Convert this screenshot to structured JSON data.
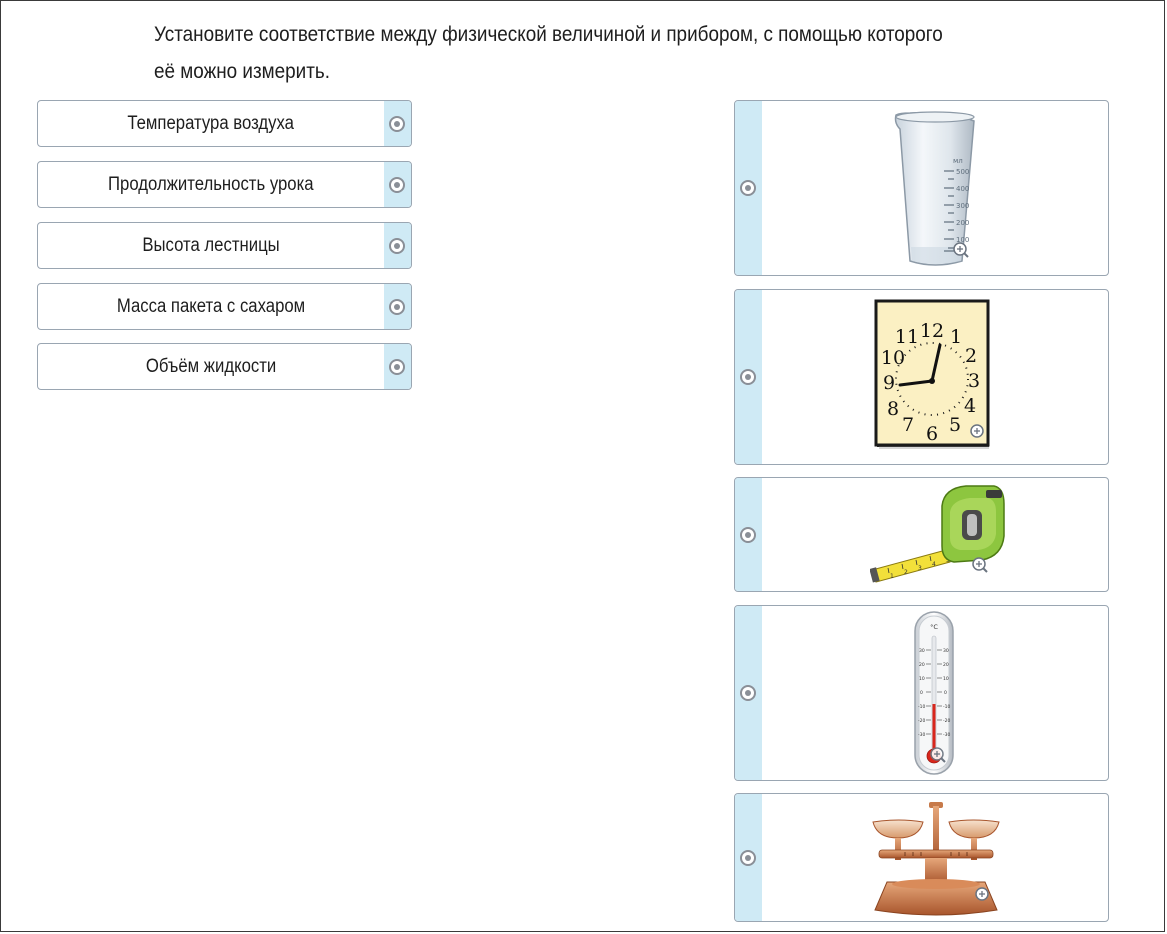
{
  "question": {
    "line1": "Установите соответствие между физической величиной и прибором, с помощью которого",
    "line2": "её можно измерить."
  },
  "left_items": [
    {
      "label": "Температура воздуха"
    },
    {
      "label": "Продолжительность урока"
    },
    {
      "label": "Высота лестницы"
    },
    {
      "label": "Масса пакета с сахаром"
    },
    {
      "label": "Объём жидкости"
    }
  ],
  "right_items": [
    {
      "icon": "measuring-cup-icon",
      "unit": "мл",
      "ticks": [
        "500",
        "400",
        "300",
        "200",
        "100",
        "50"
      ]
    },
    {
      "icon": "wall-clock-icon",
      "numbers": [
        "12",
        "1",
        "2",
        "3",
        "4",
        "5",
        "6",
        "7",
        "8",
        "9",
        "10",
        "11"
      ]
    },
    {
      "icon": "tape-measure-icon",
      "ticks": [
        "1",
        "2",
        "3",
        "4",
        "5"
      ]
    },
    {
      "icon": "thermometer-icon",
      "unit": "°C",
      "ticks": [
        "30",
        "20",
        "10",
        "0",
        "-10",
        "-20",
        "-30"
      ]
    },
    {
      "icon": "balance-scale-icon"
    }
  ],
  "colors": {
    "strip": "#cfeaf5",
    "border": "#9aa6b2",
    "radio": "#8a8f97",
    "text": "#1e1e1e"
  }
}
